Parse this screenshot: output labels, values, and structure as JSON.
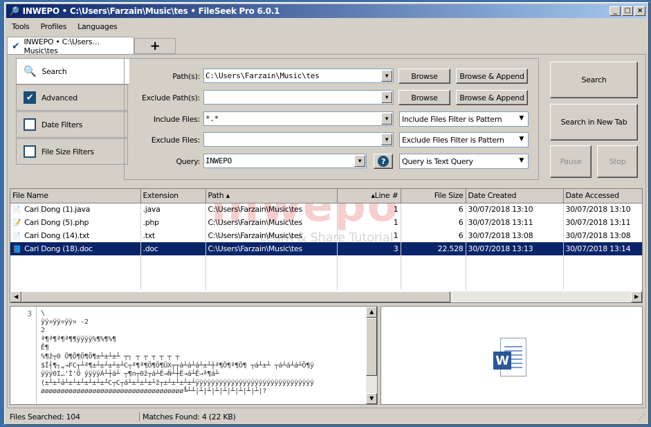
{
  "window": {
    "title": "INWEPO • C:\\Users\\Farzain\\Music\\tes • FileSeek Pro 6.0.1",
    "min": "_",
    "max": "□",
    "close": "×"
  },
  "menu": [
    "Tools",
    "Profiles",
    "Languages"
  ],
  "tabs": {
    "active": "INWEPO • C:\\Users…Music\\tes",
    "add": "+"
  },
  "sidebar": [
    {
      "label": "Search"
    },
    {
      "label": "Advanced",
      "checked": true
    },
    {
      "label": "Date Filters",
      "checked": false
    },
    {
      "label": "File Size Filters",
      "checked": false
    }
  ],
  "form": {
    "path_label": "Path(s):",
    "path_value": "C:\\Users\\Farzain\\Music\\tes",
    "exclude_path_label": "Exclude Path(s):",
    "exclude_path_value": "",
    "include_files_label": "Include Files:",
    "include_files_value": "*.*",
    "exclude_files_label": "Exclude Files:",
    "exclude_files_value": "",
    "query_label": "Query:",
    "query_value": "INWEPO",
    "browse": "Browse",
    "browse_append": "Browse & Append",
    "include_mode": "Include Files Filter is Pattern",
    "exclude_mode": "Exclude Files Filter is Pattern",
    "query_mode": "Query is Text Query",
    "help": "?"
  },
  "actions": {
    "search": "Search",
    "search_new_tab": "Search in New Tab",
    "pause": "Pause",
    "stop": "Stop"
  },
  "results": {
    "columns": [
      "File Name",
      "Extension",
      "Path ▴",
      "▴Line #",
      "File Size",
      "Date Created",
      "Date Accessed"
    ],
    "rows": [
      {
        "name": "Cari Dong (1).java",
        "ext": ".java",
        "path": "C:\\Users\\Farzain\\Music\\tes",
        "line": "1",
        "size": "6",
        "created": "30/07/2018 13:10",
        "accessed": "30/07/2018 13:10"
      },
      {
        "name": "Cari Dong (5).php",
        "ext": ".php",
        "path": "C:\\Users\\Farzain\\Music\\tes",
        "line": "1",
        "size": "6",
        "created": "30/07/2018 13:11",
        "accessed": "30/07/2018 13:11"
      },
      {
        "name": "Cari Dong (14).txt",
        "ext": ".txt",
        "path": "C:\\Users\\Farzain\\Music\\tes",
        "line": "1",
        "size": "6",
        "created": "30/07/2018 13:08",
        "accessed": "30/07/2018 13:08"
      },
      {
        "name": "Cari Dong (18).doc",
        "ext": ".doc",
        "path": "C:\\Users\\Farzain\\Music\\tes",
        "line": "3",
        "size": "22.528",
        "created": "30/07/2018 13:13",
        "accessed": "30/07/2018 13:14"
      }
    ]
  },
  "preview": {
    "line_number": "3",
    "text": "\\\nÿÿ¤ÿÿ¤ÿÿ¤ -2\n2\nª¶ª¶ª¶ª¶¶ÿÿÿÿ%¶%¶%¶\nÊ¶\n%¶ž┬0 Ö¶Ö¶Ö¶Ö¶±┴±┴±┴ ┬┐ ┬ ┬ ┬ ┬ ┬ ┬\n$Î┤¶┐„→FC┬┴ª¶±┴±┴±┴±┴C┬ª¶ª¶Ö¶Ö¶ÛX┬┬á┴á┴á┴±┴┼ª¶Ö¶ª¶Ö¶ ┬á┴±┴ ┬á┴á┴á┴Ö¶ÿ\nÿÿÿ0I…'Ì'Ö ÿÿÿÿÁ┴┼á┴ ┬¶n┬0ž┬á┴Ê→Ñ┴┼Ê→á┴Ê→ª¶á┴\n(±┴±┴á┴±┴±┴±┴±┴±┴C┬C┬á┴±┴±┴±┴ž┬±┴±┴±┴±┴ÿÿÿÿÿÿÿÿÿÿÿÿÿÿÿÿÿÿÿÿÿÿÿÿÿÿÿÿÿÿ\nøøøøøøøøøøøøøøøøøøøøøøøøøøøøøøøøøøøø╚┴┴|┴|┴|┴|┴|┴|┴|┴|┴|?"
  },
  "status": {
    "files_searched": "Files Searched: 104",
    "matches": "Matches Found: 4 (22 KB)"
  },
  "watermark": {
    "brand": "inwepo",
    "tagline": "Learn & Share Tutorial"
  }
}
